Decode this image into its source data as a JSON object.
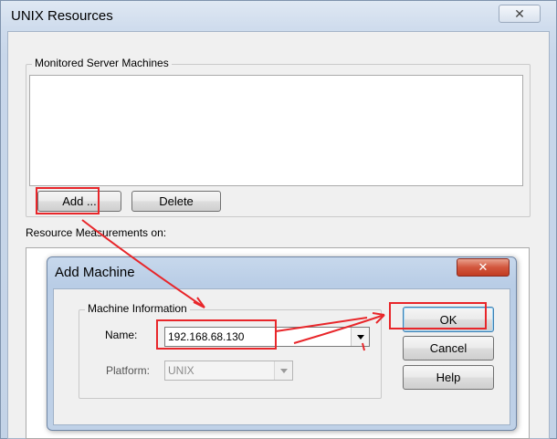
{
  "outer_window": {
    "title": "UNIX Resources",
    "close_glyph": "✕",
    "monitored_group_label": "Monitored Server Machines",
    "add_button_label": "Add ...",
    "delete_button_label": "Delete",
    "measurements_label": "Resource Measurements on:"
  },
  "add_machine_dialog": {
    "title": "Add Machine",
    "close_glyph": "✕",
    "group_label": "Machine Information",
    "name_label": "Name:",
    "name_value": "192.168.68.130",
    "platform_label": "Platform:",
    "platform_value": "UNIX",
    "ok_label": "OK",
    "cancel_label": "Cancel",
    "help_label": "Help"
  },
  "annotations": {
    "color": "#e8262a"
  }
}
